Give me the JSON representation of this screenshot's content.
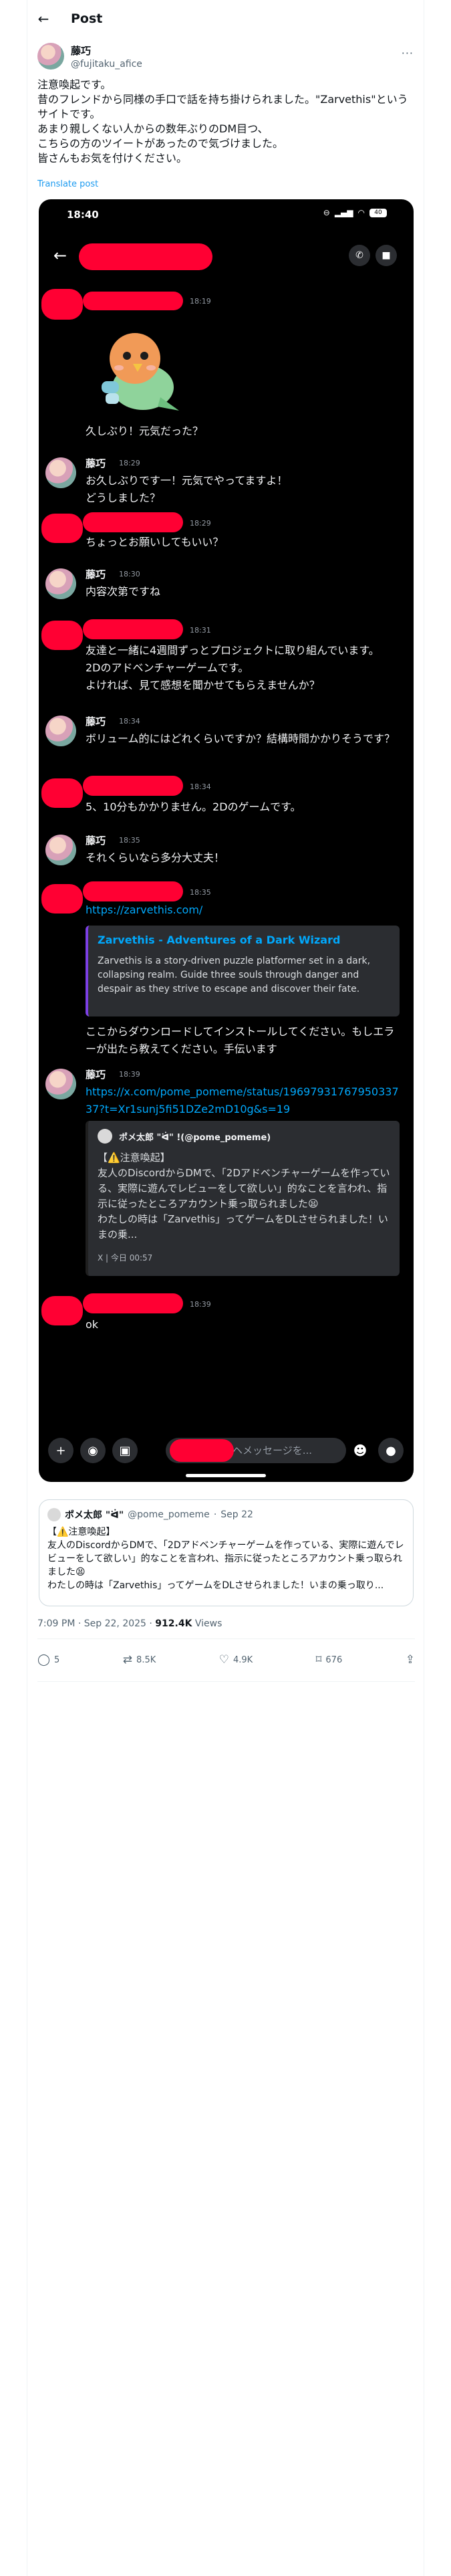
{
  "header": {
    "title": "Post"
  },
  "author": {
    "display_name": "藤巧",
    "handle": "@fujitaku_afice"
  },
  "tweet": {
    "text": "注意喚起です。\n昔のフレンドから同様の手口で話を持ち掛けられました。\"Zarvethis\"というサイトです。\nあまり親しくない人からの数年ぶりのDM目つ、\nこちらの方のツイートがあったので気づけました。\n皆さんもお気を付けください。",
    "translate_label": "Translate post"
  },
  "screenshot": {
    "status_time": "18:40",
    "battery": "40",
    "messages": [
      {
        "id": "m1",
        "sender": "",
        "time": "18:19",
        "text": "久しぶり！元気だった？"
      },
      {
        "id": "m2",
        "sender": "藤巧",
        "time": "18:29",
        "text": "お久しぶりです一！元気でやってますよ！\nどうしました？"
      },
      {
        "id": "m3",
        "sender": "",
        "time": "18:29",
        "text": "ちょっとお願いしてもいい？"
      },
      {
        "id": "m4",
        "sender": "藤巧",
        "time": "18:30",
        "text": "内容次第ですね"
      },
      {
        "id": "m5",
        "sender": "",
        "time": "18:31",
        "text": "友達と一緒に4週間ずっとプロジェクトに取り組んでいます。\n2Dのアドベンチャーゲームです。\nよければ、見て感想を聞かせてもらえませんか？"
      },
      {
        "id": "m6",
        "sender": "藤巧",
        "time": "18:34",
        "text": "ボリューム的にはどれくらいですか？結構時間かかりそうです？"
      },
      {
        "id": "m7",
        "sender": "",
        "time": "18:34",
        "text": "5、10分もかかりません。2Dのゲームです。"
      },
      {
        "id": "m8",
        "sender": "藤巧",
        "time": "18:35",
        "text": "それくらいなら多分大丈夫！"
      },
      {
        "id": "m9",
        "sender": "",
        "time": "18:35",
        "link": "https://zarvethis.com/",
        "embed_title": "Zarvethis - Adventures of a Dark Wizard",
        "embed_desc": "Zarvethis is a story-driven puzzle platformer set in a dark, collapsing realm. Guide three souls through danger and despair as they strive to escape and discover their fate.",
        "text": "ここからダウンロードしてインストールしてください。もしエラーが出たら教えてください。手伝います"
      },
      {
        "id": "m10",
        "sender": "藤巧",
        "time": "18:39",
        "link": "https://x.com/pome_pomeme/status/1969793176795033737?t=Xr1sunj5fi51DZe2mD10g&s=19",
        "x_author": "ポメ太郎 \"ᐛ\" !(@pome_pomeme)",
        "x_text": "【⚠️注意喚起】\n友人のDiscordからDMで、「2Dアドベンチャーゲームを作っている、実際に遊んでレビューをして欲しい」的なことを言われ、指示に従ったところアカウント乗っ取られました😫\nわたしの時は「Zarvethis」ってゲームをDLさせられました！いまの乗...",
        "x_footer": "X | 今日 00:57"
      },
      {
        "id": "m11",
        "sender": "",
        "time": "18:39",
        "text": "ok"
      }
    ],
    "composer_placeholder": "ヘメッセージを..."
  },
  "quote": {
    "name": "ポメ太郎 \"ᐛ\"",
    "handle": "@pome_pomeme",
    "date": "Sep 22",
    "text": "【⚠️注意喚起】\n友人のDiscordからDMで、「2Dアドベンチャーゲームを作っている、実際に遊んでレビューをして欲しい」的なことを言われ、指示に従ったところアカウント乗っ取られました😫\nわたしの時は「Zarvethis」ってゲームをDLさせられました！いまの乗っ取り..."
  },
  "meta": {
    "timestamp": "7:09 PM · Sep 22, 2025 · ",
    "views_count": "912.4K",
    "views_label": " Views"
  },
  "actions": {
    "replies": "5",
    "reposts": "8.5K",
    "likes": "4.9K",
    "bookmarks": "676"
  },
  "colors": {
    "accent": "#1d9bf0",
    "discord_bg": "#000000",
    "redaction": "#ff0033",
    "discord_link": "#00a8fc"
  }
}
